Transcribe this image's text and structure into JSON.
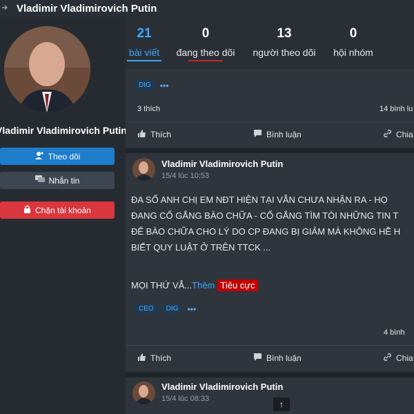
{
  "header": {
    "title": "Vladimir Vladimirovich Putin"
  },
  "sidebar": {
    "name": "Vladimir Vladimirovich Putin",
    "follow_label": "Theo dõi",
    "message_label": "Nhắn tin",
    "block_label": "Chặn tài khoản"
  },
  "tabs": [
    {
      "count": "21",
      "label": "bài viết"
    },
    {
      "count": "0",
      "label": "đang theo dõi"
    },
    {
      "count": "13",
      "label": "người theo dõi"
    },
    {
      "count": "0",
      "label": "hội nhóm"
    }
  ],
  "posts": [
    {
      "tags": [
        "DIG"
      ],
      "likes": "3 thích",
      "comments": "14 bình lu",
      "actions": {
        "like": "Thích",
        "comment": "Bình luận",
        "share": "Chia"
      }
    },
    {
      "author": "Vladimir Vladimirovich Putin",
      "time": "15/4 lúc 10:53",
      "body": [
        "ĐA SỐ ANH CHỊ EM NĐT HIỆN TẠI VẪN CHƯA NHẬN RA - HỌ",
        "ĐANG CỐ GẮNG BÀO CHỮA - CỐ GẮNG TÌM TÒI NHỮNG TIN T",
        "ĐỂ BÀO CHỮA CHO LÝ DO CP ĐANG BỊ GIẢM MÀ KHÔNG HỀ H",
        "BIẾT QUY LUẬT Ở TRÊN TTCK ..."
      ],
      "more_text": "MỌI THỨ VẪ...",
      "more_link": "Thêm",
      "sentiment": "Tiêu cực",
      "tags": [
        "CEO",
        "DIG"
      ],
      "comments": "4 bình",
      "actions": {
        "like": "Thích",
        "comment": "Bình luận",
        "share": "Chia"
      }
    },
    {
      "author": "Vladimir Vladimirovich Putin",
      "time": "15/4 lúc 08:33"
    }
  ],
  "scroll_top_icon": "↑"
}
